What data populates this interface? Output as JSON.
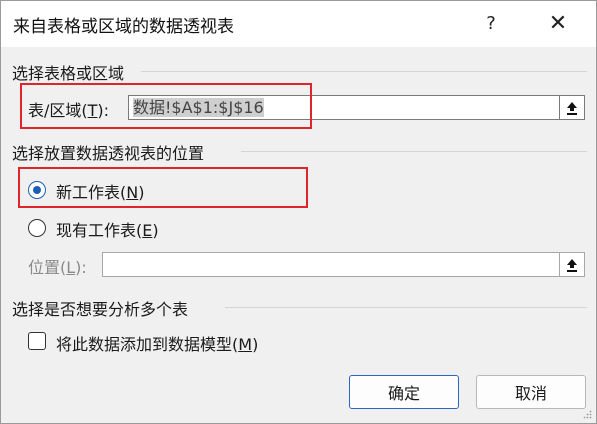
{
  "dialog": {
    "title": "来自表格或区域的数据透视表",
    "help_glyph": "?",
    "close_glyph": "✕"
  },
  "section_range": {
    "heading": "选择表格或区域",
    "label_prefix": "表/区域(",
    "label_key": "T",
    "label_suffix": "):",
    "value": "数据!$A$1:$J$16"
  },
  "section_placement": {
    "heading": "选择放置数据透视表的位置",
    "options": [
      {
        "prefix": "新工作表(",
        "key": "N",
        "suffix": ")",
        "checked": true
      },
      {
        "prefix": "现有工作表(",
        "key": "E",
        "suffix": ")",
        "checked": false
      }
    ],
    "location_prefix": "位置(",
    "location_key": "L",
    "location_suffix": "):",
    "location_value": ""
  },
  "section_multi": {
    "heading": "选择是否想要分析多个表",
    "checkbox_prefix": "将此数据添加到数据模型(",
    "checkbox_key": "M",
    "checkbox_suffix": ")",
    "checked": false
  },
  "buttons": {
    "ok": "确定",
    "cancel": "取消"
  },
  "colors": {
    "accent": "#1e5fb4",
    "highlight": "#e0242b"
  },
  "icons": {
    "collapse": "collapse-dialog-icon"
  }
}
